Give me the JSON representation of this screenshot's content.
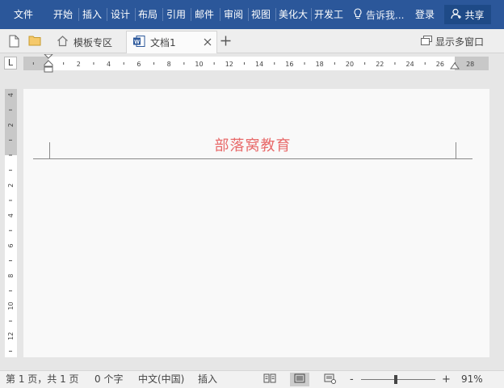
{
  "ribbon": {
    "tabs": [
      "文件",
      "开始",
      "插入",
      "设计",
      "布局",
      "引用",
      "邮件",
      "审阅",
      "视图",
      "美化大",
      "开发工"
    ],
    "tell_me": "告诉我...",
    "login": "登录",
    "share": "共享",
    "accent": "#2b579a"
  },
  "tabbar": {
    "template_tab": "模板专区",
    "document_tab": "文档1",
    "multi_window": "显示多窗口"
  },
  "rulers": {
    "horizontal_labels": [
      "2",
      "4",
      "6",
      "8",
      "10",
      "12",
      "14",
      "16",
      "18",
      "20",
      "22",
      "24",
      "26",
      "28"
    ],
    "vertical_labels": [
      "4",
      "2",
      "2",
      "4",
      "6",
      "8",
      "10",
      "12"
    ],
    "tab_selector": "L"
  },
  "document": {
    "header_text": "部落窝教育",
    "header_color": "#e86a6a"
  },
  "status": {
    "page": "第 1 页，共 1 页",
    "words": "0 个字",
    "language": "中文(中国)",
    "mode": "插入",
    "zoom": "91%",
    "zoom_minus": "-",
    "zoom_plus": "+"
  }
}
